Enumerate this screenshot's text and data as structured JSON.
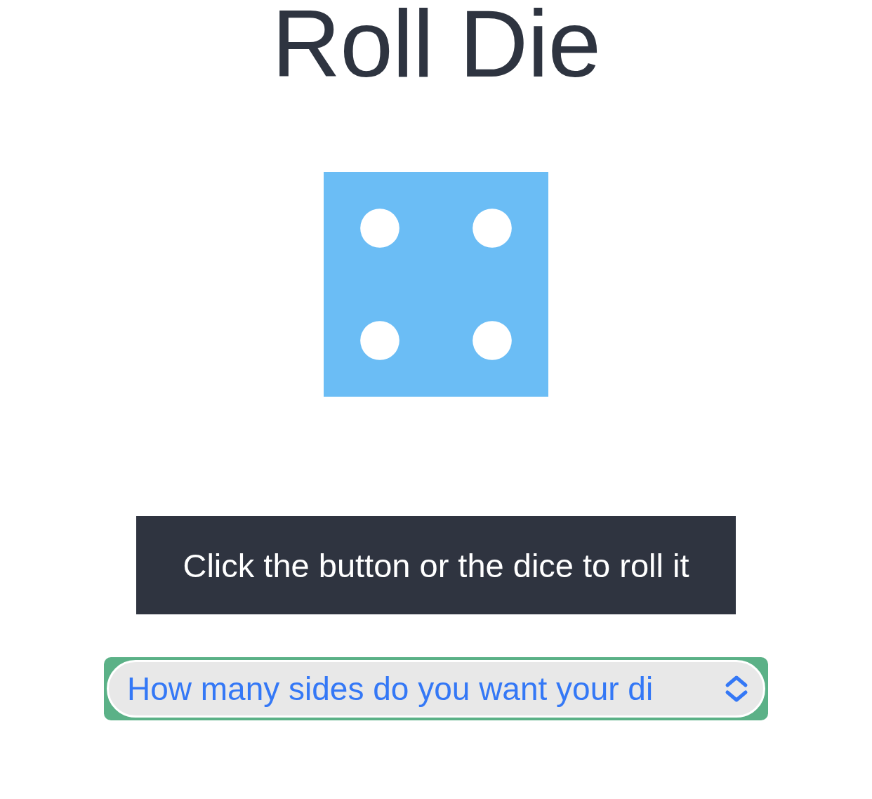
{
  "title": "Roll Die",
  "die": {
    "kind": "four"
  },
  "roll_button": {
    "label": "Click the button or the dice to roll it"
  },
  "sides_select": {
    "placeholder": "How many sides do you want your di"
  }
}
